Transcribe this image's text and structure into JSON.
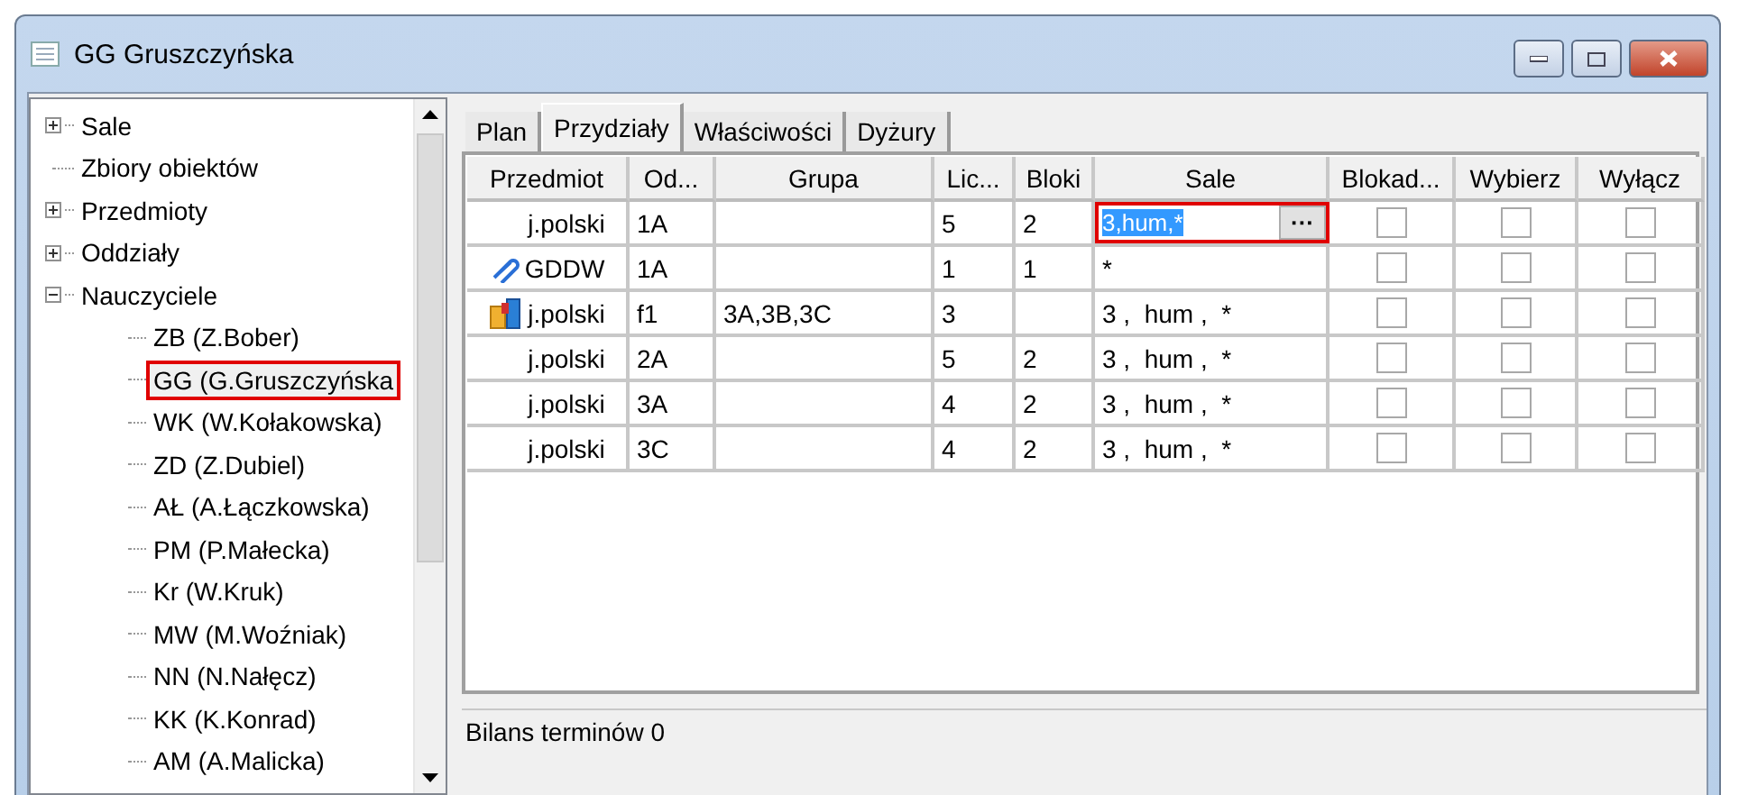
{
  "window": {
    "title": "GG Gruszczyńska"
  },
  "tree": [
    {
      "label": "Sale",
      "expanded": false
    },
    {
      "label": "Zbiory obiektów"
    },
    {
      "label": "Przedmioty",
      "expanded": false
    },
    {
      "label": "Oddziały",
      "expanded": false
    },
    {
      "label": "Nauczyciele",
      "expanded": true,
      "children": [
        {
          "label": "ZB (Z.Bober)",
          "selected": false
        },
        {
          "label": "GG (G.Gruszczyńska",
          "selected": true
        },
        {
          "label": "WK (W.Kołakowska)",
          "selected": false
        },
        {
          "label": "ZD (Z.Dubiel)",
          "selected": false
        },
        {
          "label": "AŁ (A.Łączkowska)",
          "selected": false
        },
        {
          "label": "PM (P.Małecka)",
          "selected": false
        },
        {
          "label": "Kr (W.Kruk)",
          "selected": false
        },
        {
          "label": "MW (M.Woźniak)",
          "selected": false
        },
        {
          "label": "NN (N.Nałęcz)",
          "selected": false
        },
        {
          "label": "KK (K.Konrad)",
          "selected": false
        },
        {
          "label": "AM (A.Malicka)",
          "selected": false
        }
      ]
    }
  ],
  "tabs": [
    {
      "label": "Plan",
      "selected": false
    },
    {
      "label": "Przydziały",
      "selected": true
    },
    {
      "label": "Właściwości",
      "selected": false
    },
    {
      "label": "Dyżury",
      "selected": false
    }
  ],
  "table": {
    "columns": [
      "Przedmiot",
      "Od...",
      "Grupa",
      "Lic...",
      "Bloki",
      "Sale",
      "Blokad...",
      "Wybierz",
      "Wyłącz"
    ],
    "rows": [
      {
        "kind": "plain",
        "przedmiot": "j.polski",
        "oddzial": "1A",
        "grupa": "",
        "lic": "5",
        "bloki": "2",
        "sale": "3,hum,*",
        "editing": true,
        "blokada": false,
        "wybierz": false,
        "wylacz": false
      },
      {
        "kind": "attachment",
        "przedmiot": "GDDW",
        "oddzial": "1A",
        "grupa": "",
        "lic": "1",
        "bloki": "1",
        "sale": "*",
        "editing": false,
        "blokada": false,
        "wybierz": false,
        "wylacz": false
      },
      {
        "kind": "group",
        "przedmiot": "j.polski",
        "oddzial": "f1",
        "grupa": "3A,3B,3C",
        "lic": "3",
        "bloki": "",
        "sale": "3 ,  hum ,  *",
        "editing": false,
        "blokada": false,
        "wybierz": false,
        "wylacz": false
      },
      {
        "kind": "plain",
        "przedmiot": "j.polski",
        "oddzial": "2A",
        "grupa": "",
        "lic": "5",
        "bloki": "2",
        "sale": "3 ,  hum ,  *",
        "editing": false,
        "blokada": false,
        "wybierz": false,
        "wylacz": false
      },
      {
        "kind": "plain",
        "przedmiot": "j.polski",
        "oddzial": "3A",
        "grupa": "",
        "lic": "4",
        "bloki": "2",
        "sale": "3 ,  hum ,  *",
        "editing": false,
        "blokada": false,
        "wybierz": false,
        "wylacz": false
      },
      {
        "kind": "plain",
        "przedmiot": "j.polski",
        "oddzial": "3C",
        "grupa": "",
        "lic": "4",
        "bloki": "2",
        "sale": "3 ,  hum ,  *",
        "editing": false,
        "blokada": false,
        "wybierz": false,
        "wylacz": false
      }
    ]
  },
  "edit_button": "···",
  "status_bar": "Bilans terminów 0"
}
